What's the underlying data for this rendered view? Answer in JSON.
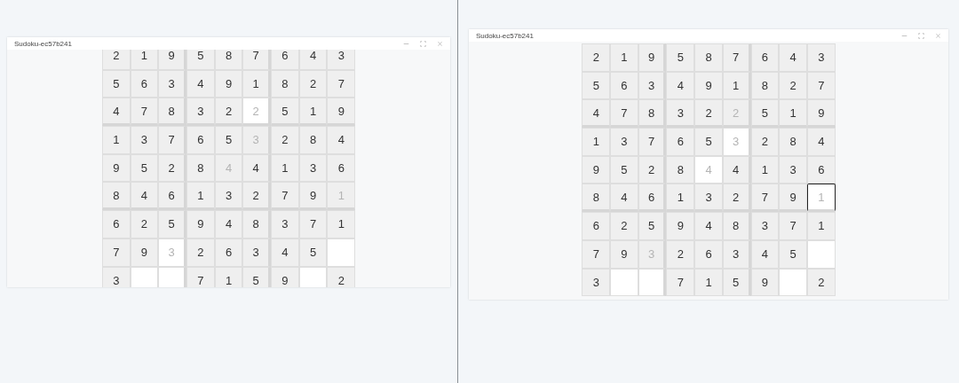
{
  "windows": [
    {
      "title": "Sudoku-ec57b241",
      "rows": [
        [
          {
            "value": "2",
            "given": true,
            "highlighted": false,
            "selected": false
          },
          {
            "value": "1",
            "given": true,
            "highlighted": false,
            "selected": false
          },
          {
            "value": "9",
            "given": true,
            "highlighted": false,
            "selected": false
          },
          {
            "value": "5",
            "given": true,
            "highlighted": false,
            "selected": false
          },
          {
            "value": "8",
            "given": true,
            "highlighted": false,
            "selected": false
          },
          {
            "value": "7",
            "given": true,
            "highlighted": false,
            "selected": false
          },
          {
            "value": "6",
            "given": true,
            "highlighted": false,
            "selected": false
          },
          {
            "value": "4",
            "given": true,
            "highlighted": false,
            "selected": false
          },
          {
            "value": "3",
            "given": true,
            "highlighted": false,
            "selected": false
          }
        ],
        [
          {
            "value": "5",
            "given": true,
            "highlighted": false,
            "selected": false
          },
          {
            "value": "6",
            "given": true,
            "highlighted": false,
            "selected": false
          },
          {
            "value": "3",
            "given": true,
            "highlighted": false,
            "selected": false
          },
          {
            "value": "4",
            "given": true,
            "highlighted": false,
            "selected": false
          },
          {
            "value": "9",
            "given": true,
            "highlighted": false,
            "selected": false
          },
          {
            "value": "1",
            "given": true,
            "highlighted": false,
            "selected": false
          },
          {
            "value": "8",
            "given": true,
            "highlighted": false,
            "selected": false
          },
          {
            "value": "2",
            "given": true,
            "highlighted": false,
            "selected": false
          },
          {
            "value": "7",
            "given": true,
            "highlighted": false,
            "selected": false
          }
        ],
        [
          {
            "value": "4",
            "given": true,
            "highlighted": false,
            "selected": false
          },
          {
            "value": "7",
            "given": true,
            "highlighted": false,
            "selected": false
          },
          {
            "value": "8",
            "given": true,
            "highlighted": false,
            "selected": false
          },
          {
            "value": "3",
            "given": true,
            "highlighted": false,
            "selected": false
          },
          {
            "value": "2",
            "given": true,
            "highlighted": false,
            "selected": false
          },
          {
            "value": "2",
            "given": false,
            "highlighted": true,
            "selected": false
          },
          {
            "value": "5",
            "given": true,
            "highlighted": false,
            "selected": false
          },
          {
            "value": "1",
            "given": true,
            "highlighted": false,
            "selected": false
          },
          {
            "value": "9",
            "given": true,
            "highlighted": false,
            "selected": false
          }
        ],
        [
          {
            "value": "1",
            "given": true,
            "highlighted": false,
            "selected": false
          },
          {
            "value": "3",
            "given": true,
            "highlighted": false,
            "selected": false
          },
          {
            "value": "7",
            "given": true,
            "highlighted": false,
            "selected": false
          },
          {
            "value": "6",
            "given": true,
            "highlighted": false,
            "selected": false
          },
          {
            "value": "5",
            "given": true,
            "highlighted": false,
            "selected": false
          },
          {
            "value": "3",
            "given": false,
            "highlighted": false,
            "selected": false
          },
          {
            "value": "2",
            "given": true,
            "highlighted": false,
            "selected": false
          },
          {
            "value": "8",
            "given": true,
            "highlighted": false,
            "selected": false
          },
          {
            "value": "4",
            "given": true,
            "highlighted": false,
            "selected": false
          }
        ],
        [
          {
            "value": "9",
            "given": true,
            "highlighted": false,
            "selected": false
          },
          {
            "value": "5",
            "given": true,
            "highlighted": false,
            "selected": false
          },
          {
            "value": "2",
            "given": true,
            "highlighted": false,
            "selected": false
          },
          {
            "value": "8",
            "given": true,
            "highlighted": false,
            "selected": false
          },
          {
            "value": "4",
            "given": false,
            "highlighted": false,
            "selected": false
          },
          {
            "value": "4",
            "given": true,
            "highlighted": false,
            "selected": false
          },
          {
            "value": "1",
            "given": true,
            "highlighted": false,
            "selected": false
          },
          {
            "value": "3",
            "given": true,
            "highlighted": false,
            "selected": false
          },
          {
            "value": "6",
            "given": true,
            "highlighted": false,
            "selected": false
          }
        ],
        [
          {
            "value": "8",
            "given": true,
            "highlighted": false,
            "selected": false
          },
          {
            "value": "4",
            "given": true,
            "highlighted": false,
            "selected": false
          },
          {
            "value": "6",
            "given": true,
            "highlighted": false,
            "selected": false
          },
          {
            "value": "1",
            "given": true,
            "highlighted": false,
            "selected": false
          },
          {
            "value": "3",
            "given": true,
            "highlighted": false,
            "selected": false
          },
          {
            "value": "2",
            "given": true,
            "highlighted": false,
            "selected": false
          },
          {
            "value": "7",
            "given": true,
            "highlighted": false,
            "selected": false
          },
          {
            "value": "9",
            "given": true,
            "highlighted": false,
            "selected": false
          },
          {
            "value": "1",
            "given": false,
            "highlighted": false,
            "selected": false
          }
        ],
        [
          {
            "value": "6",
            "given": true,
            "highlighted": false,
            "selected": false
          },
          {
            "value": "2",
            "given": true,
            "highlighted": false,
            "selected": false
          },
          {
            "value": "5",
            "given": true,
            "highlighted": false,
            "selected": false
          },
          {
            "value": "9",
            "given": true,
            "highlighted": false,
            "selected": false
          },
          {
            "value": "4",
            "given": true,
            "highlighted": false,
            "selected": false
          },
          {
            "value": "8",
            "given": true,
            "highlighted": false,
            "selected": false
          },
          {
            "value": "3",
            "given": true,
            "highlighted": false,
            "selected": false
          },
          {
            "value": "7",
            "given": true,
            "highlighted": false,
            "selected": false
          },
          {
            "value": "1",
            "given": true,
            "highlighted": false,
            "selected": false
          }
        ],
        [
          {
            "value": "7",
            "given": true,
            "highlighted": false,
            "selected": false
          },
          {
            "value": "9",
            "given": true,
            "highlighted": false,
            "selected": false
          },
          {
            "value": "3",
            "given": false,
            "highlighted": true,
            "selected": false
          },
          {
            "value": "2",
            "given": true,
            "highlighted": false,
            "selected": false
          },
          {
            "value": "6",
            "given": true,
            "highlighted": false,
            "selected": false
          },
          {
            "value": "3",
            "given": true,
            "highlighted": false,
            "selected": false
          },
          {
            "value": "4",
            "given": true,
            "highlighted": false,
            "selected": false
          },
          {
            "value": "5",
            "given": true,
            "highlighted": false,
            "selected": false
          },
          {
            "given": false,
            "highlighted": true,
            "selected": false
          }
        ],
        [
          {
            "value": "3",
            "given": true,
            "highlighted": false,
            "selected": false
          },
          {
            "given": false,
            "highlighted": true,
            "selected": false
          },
          {
            "given": false,
            "highlighted": true,
            "selected": false
          },
          {
            "value": "7",
            "given": true,
            "highlighted": false,
            "selected": false
          },
          {
            "value": "1",
            "given": true,
            "highlighted": false,
            "selected": false
          },
          {
            "value": "5",
            "given": true,
            "highlighted": false,
            "selected": false
          },
          {
            "value": "9",
            "given": true,
            "highlighted": false,
            "selected": false
          },
          {
            "given": false,
            "highlighted": true,
            "selected": false
          },
          {
            "value": "2",
            "given": true,
            "highlighted": false,
            "selected": false
          }
        ]
      ]
    },
    {
      "title": "Sudoku-ec57b241",
      "rows": [
        [
          {
            "value": "2",
            "given": true,
            "highlighted": false,
            "selected": false
          },
          {
            "value": "1",
            "given": true,
            "highlighted": false,
            "selected": false
          },
          {
            "value": "9",
            "given": true,
            "highlighted": false,
            "selected": false
          },
          {
            "value": "5",
            "given": true,
            "highlighted": false,
            "selected": false
          },
          {
            "value": "8",
            "given": true,
            "highlighted": false,
            "selected": false
          },
          {
            "value": "7",
            "given": true,
            "highlighted": false,
            "selected": false
          },
          {
            "value": "6",
            "given": true,
            "highlighted": false,
            "selected": false
          },
          {
            "value": "4",
            "given": true,
            "highlighted": false,
            "selected": false
          },
          {
            "value": "3",
            "given": true,
            "highlighted": false,
            "selected": false
          }
        ],
        [
          {
            "value": "5",
            "given": true,
            "highlighted": false,
            "selected": false
          },
          {
            "value": "6",
            "given": true,
            "highlighted": false,
            "selected": false
          },
          {
            "value": "3",
            "given": true,
            "highlighted": false,
            "selected": false
          },
          {
            "value": "4",
            "given": true,
            "highlighted": false,
            "selected": false
          },
          {
            "value": "9",
            "given": true,
            "highlighted": false,
            "selected": false
          },
          {
            "value": "1",
            "given": true,
            "highlighted": false,
            "selected": false
          },
          {
            "value": "8",
            "given": true,
            "highlighted": false,
            "selected": false
          },
          {
            "value": "2",
            "given": true,
            "highlighted": false,
            "selected": false
          },
          {
            "value": "7",
            "given": true,
            "highlighted": false,
            "selected": false
          }
        ],
        [
          {
            "value": "4",
            "given": true,
            "highlighted": false,
            "selected": false
          },
          {
            "value": "7",
            "given": true,
            "highlighted": false,
            "selected": false
          },
          {
            "value": "8",
            "given": true,
            "highlighted": false,
            "selected": false
          },
          {
            "value": "3",
            "given": true,
            "highlighted": false,
            "selected": false
          },
          {
            "value": "2",
            "given": true,
            "highlighted": false,
            "selected": false
          },
          {
            "value": "2",
            "given": false,
            "highlighted": false,
            "selected": false
          },
          {
            "value": "5",
            "given": true,
            "highlighted": false,
            "selected": false
          },
          {
            "value": "1",
            "given": true,
            "highlighted": false,
            "selected": false
          },
          {
            "value": "9",
            "given": true,
            "highlighted": false,
            "selected": false
          }
        ],
        [
          {
            "value": "1",
            "given": true,
            "highlighted": false,
            "selected": false
          },
          {
            "value": "3",
            "given": true,
            "highlighted": false,
            "selected": false
          },
          {
            "value": "7",
            "given": true,
            "highlighted": false,
            "selected": false
          },
          {
            "value": "6",
            "given": true,
            "highlighted": false,
            "selected": false
          },
          {
            "value": "5",
            "given": true,
            "highlighted": false,
            "selected": false
          },
          {
            "value": "3",
            "given": false,
            "highlighted": true,
            "selected": false
          },
          {
            "value": "2",
            "given": true,
            "highlighted": false,
            "selected": false
          },
          {
            "value": "8",
            "given": true,
            "highlighted": false,
            "selected": false
          },
          {
            "value": "4",
            "given": true,
            "highlighted": false,
            "selected": false
          }
        ],
        [
          {
            "value": "9",
            "given": true,
            "highlighted": false,
            "selected": false
          },
          {
            "value": "5",
            "given": true,
            "highlighted": false,
            "selected": false
          },
          {
            "value": "2",
            "given": true,
            "highlighted": false,
            "selected": false
          },
          {
            "value": "8",
            "given": true,
            "highlighted": false,
            "selected": false
          },
          {
            "value": "4",
            "given": false,
            "highlighted": true,
            "selected": false
          },
          {
            "value": "4",
            "given": true,
            "highlighted": false,
            "selected": false
          },
          {
            "value": "1",
            "given": true,
            "highlighted": false,
            "selected": false
          },
          {
            "value": "3",
            "given": true,
            "highlighted": false,
            "selected": false
          },
          {
            "value": "6",
            "given": true,
            "highlighted": false,
            "selected": false
          }
        ],
        [
          {
            "value": "8",
            "given": true,
            "highlighted": false,
            "selected": false
          },
          {
            "value": "4",
            "given": true,
            "highlighted": false,
            "selected": false
          },
          {
            "value": "6",
            "given": true,
            "highlighted": false,
            "selected": false
          },
          {
            "value": "1",
            "given": true,
            "highlighted": false,
            "selected": false
          },
          {
            "value": "3",
            "given": true,
            "highlighted": false,
            "selected": false
          },
          {
            "value": "2",
            "given": true,
            "highlighted": false,
            "selected": false
          },
          {
            "value": "7",
            "given": true,
            "highlighted": false,
            "selected": false
          },
          {
            "value": "9",
            "given": true,
            "highlighted": false,
            "selected": false
          },
          {
            "value": "1",
            "given": false,
            "highlighted": true,
            "selected": true
          }
        ],
        [
          {
            "value": "6",
            "given": true,
            "highlighted": false,
            "selected": false
          },
          {
            "value": "2",
            "given": true,
            "highlighted": false,
            "selected": false
          },
          {
            "value": "5",
            "given": true,
            "highlighted": false,
            "selected": false
          },
          {
            "value": "9",
            "given": true,
            "highlighted": false,
            "selected": false
          },
          {
            "value": "4",
            "given": true,
            "highlighted": false,
            "selected": false
          },
          {
            "value": "8",
            "given": true,
            "highlighted": false,
            "selected": false
          },
          {
            "value": "3",
            "given": true,
            "highlighted": false,
            "selected": false
          },
          {
            "value": "7",
            "given": true,
            "highlighted": false,
            "selected": false
          },
          {
            "value": "1",
            "given": true,
            "highlighted": false,
            "selected": false
          }
        ],
        [
          {
            "value": "7",
            "given": true,
            "highlighted": false,
            "selected": false
          },
          {
            "value": "9",
            "given": true,
            "highlighted": false,
            "selected": false
          },
          {
            "value": "3",
            "given": false,
            "highlighted": false,
            "selected": false
          },
          {
            "value": "2",
            "given": true,
            "highlighted": false,
            "selected": false
          },
          {
            "value": "6",
            "given": true,
            "highlighted": false,
            "selected": false
          },
          {
            "value": "3",
            "given": true,
            "highlighted": false,
            "selected": false
          },
          {
            "value": "4",
            "given": true,
            "highlighted": false,
            "selected": false
          },
          {
            "value": "5",
            "given": true,
            "highlighted": false,
            "selected": false
          },
          {
            "given": false,
            "highlighted": true,
            "selected": false
          }
        ],
        [
          {
            "value": "3",
            "given": true,
            "highlighted": false,
            "selected": false
          },
          {
            "given": false,
            "highlighted": true,
            "selected": false
          },
          {
            "given": false,
            "highlighted": true,
            "selected": false
          },
          {
            "value": "7",
            "given": true,
            "highlighted": false,
            "selected": false
          },
          {
            "value": "1",
            "given": true,
            "highlighted": false,
            "selected": false
          },
          {
            "value": "5",
            "given": true,
            "highlighted": false,
            "selected": false
          },
          {
            "value": "9",
            "given": true,
            "highlighted": false,
            "selected": false
          },
          {
            "given": false,
            "highlighted": true,
            "selected": false
          },
          {
            "value": "2",
            "given": true,
            "highlighted": false,
            "selected": false
          }
        ]
      ]
    }
  ]
}
